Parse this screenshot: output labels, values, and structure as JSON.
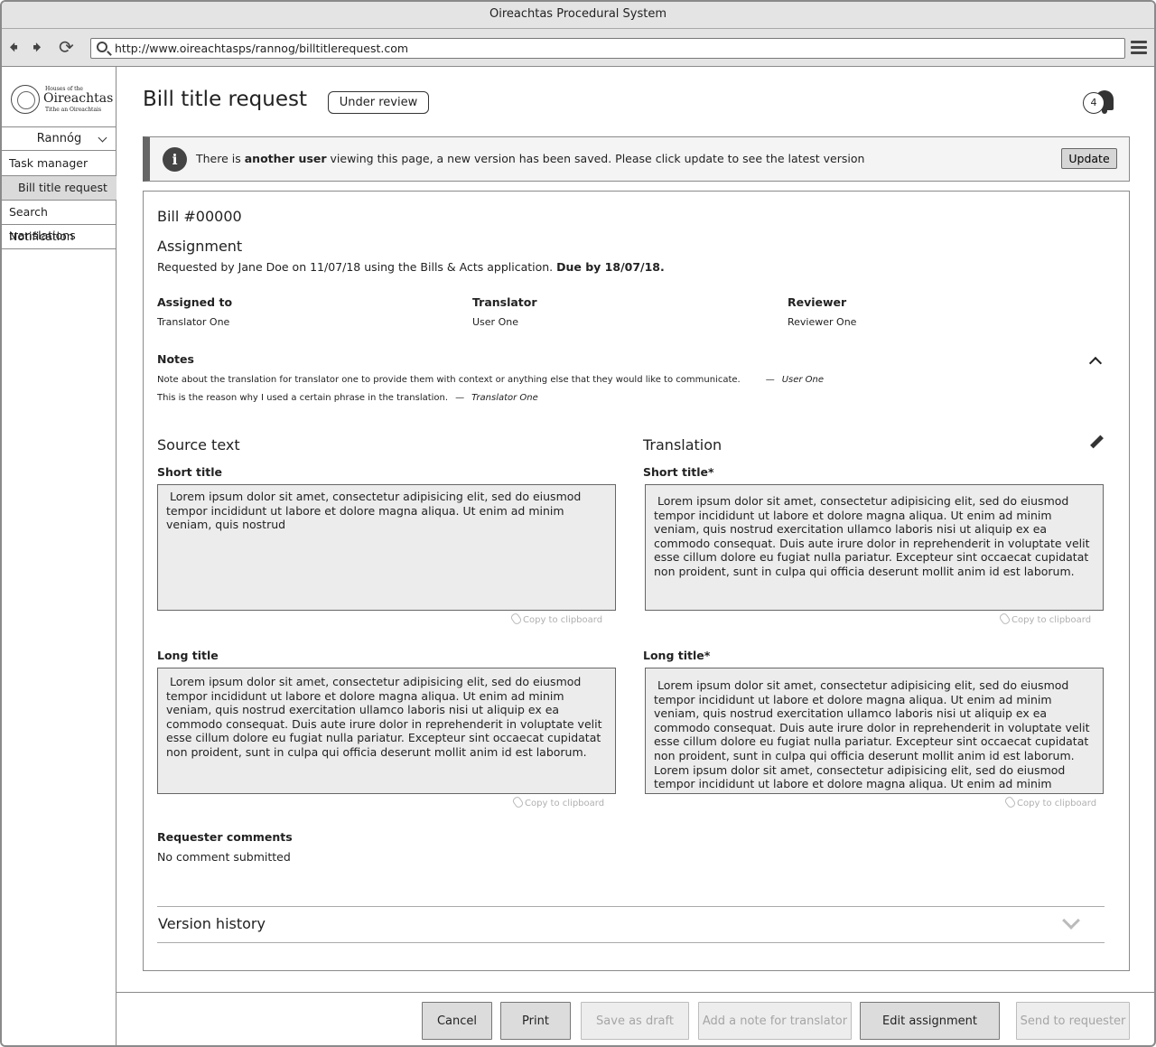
{
  "window": {
    "title": "Oireachtas Procedural System"
  },
  "browser": {
    "url": "http://www.oireachtasps/rannog/billtitlerequest.com"
  },
  "sidebar": {
    "logo": {
      "line1": "Houses of the",
      "line2": "Oireachtas",
      "line3": "Tithe an Oireachtais"
    },
    "dropdown_label": "Rannóg",
    "items": [
      {
        "label": "Task manager"
      },
      {
        "label": "Bill title request",
        "active": true
      },
      {
        "label": "Search translations"
      },
      {
        "label": "Notification"
      }
    ]
  },
  "header": {
    "title": "Bill title request",
    "status": "Under review",
    "notification_count": "4"
  },
  "alert": {
    "prefix": "There is ",
    "bold": "another user",
    "suffix": " viewing this page, a new version has been saved. Please click update to see the latest version",
    "button_label": "Update"
  },
  "bill": {
    "number": "Bill #00000",
    "assignment_title": "Assignment",
    "requested_by": "Requested by Jane Doe on 11/07/18 using the Bills & Acts application. ",
    "due": "Due by 18/07/18.",
    "columns": [
      {
        "heading": "Assigned to",
        "value": "Translator One"
      },
      {
        "heading": "Translator",
        "value": "User One"
      },
      {
        "heading": "Reviewer",
        "value": "Reviewer One"
      }
    ],
    "notes_heading": "Notes",
    "notes": [
      {
        "text": "Note about the translation for translator one to provide them with context or anything else that they would like to communicate.",
        "dash": "—",
        "author": "User One"
      },
      {
        "text": "This is the reason why I used a certain phrase in the translation.",
        "dash": "—",
        "author": "Translator One"
      }
    ]
  },
  "source": {
    "title": "Source text",
    "short_label": "Short title",
    "short_text": "Lorem ipsum dolor sit amet, consectetur adipisicing elit, sed do eiusmod tempor incididunt ut labore et dolore magna aliqua. Ut enim ad minim veniam, quis nostrud",
    "long_label": "Long title",
    "long_text": "Lorem ipsum dolor sit amet, consectetur adipisicing elit, sed do eiusmod tempor incididunt ut labore et dolore magna aliqua. Ut enim ad minim veniam, quis nostrud exercitation ullamco laboris nisi ut aliquip ex ea commodo consequat. Duis aute irure dolor in reprehenderit in voluptate velit esse cillum dolore eu fugiat nulla pariatur. Excepteur sint occaecat cupidatat non proident, sunt in culpa qui officia deserunt mollit anim id est laborum."
  },
  "translation": {
    "title": "Translation",
    "short_label": "Short title*",
    "short_text": "Lorem ipsum dolor sit amet, consectetur adipisicing elit, sed do eiusmod tempor incididunt ut labore et dolore magna aliqua. Ut enim ad minim veniam, quis nostrud exercitation ullamco laboris nisi ut aliquip ex ea commodo consequat. Duis aute irure dolor in reprehenderit in voluptate velit esse cillum dolore eu fugiat nulla pariatur. Excepteur sint occaecat cupidatat non proident, sunt in culpa qui officia deserunt mollit anim id est laborum.",
    "long_label": "Long title*",
    "long_text": "Lorem ipsum dolor sit amet, consectetur adipisicing elit, sed do eiusmod tempor incididunt ut labore et dolore magna aliqua. Ut enim ad minim veniam, quis nostrud exercitation ullamco laboris nisi ut aliquip ex ea commodo consequat. Duis aute irure dolor in reprehenderit in voluptate velit esse cillum dolore eu fugiat nulla pariatur. Excepteur sint occaecat cupidatat non proident, sunt in culpa qui officia deserunt mollit anim id est laborum. Lorem ipsum dolor sit amet, consectetur adipisicing elit, sed do eiusmod tempor incididunt ut labore et dolore magna aliqua. Ut enim ad minim veniam, quis nostrud exercitation ullamco laboris nisi ut"
  },
  "copy_label": "Copy to clipboard",
  "comments": {
    "heading": "Requester comments",
    "value": "No comment submitted"
  },
  "version_history": {
    "title": "Version history"
  },
  "footer": {
    "cancel": "Cancel",
    "print": "Print",
    "save_draft": "Save as draft",
    "add_note": "Add a note for translator",
    "edit_assignment": "Edit assignment",
    "send": "Send to requester"
  }
}
